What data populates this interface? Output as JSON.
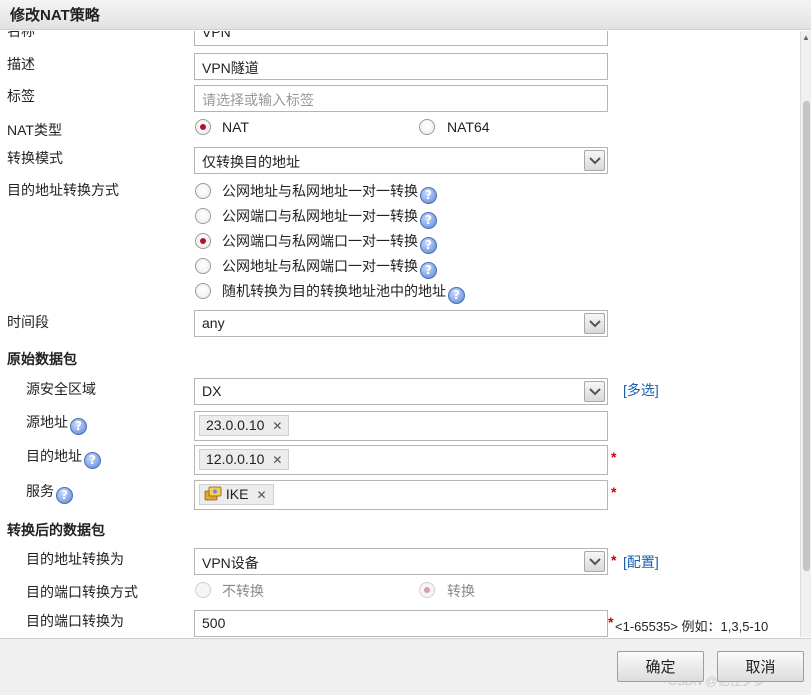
{
  "dialog": {
    "title": "修改NAT策略"
  },
  "form": {
    "name": {
      "label": "名称",
      "value": "VPN"
    },
    "description": {
      "label": "描述",
      "value": "VPN隧道"
    },
    "tag": {
      "label": "标签",
      "placeholder": "请选择或输入标签"
    },
    "nat_type": {
      "label": "NAT类型",
      "options": [
        "NAT",
        "NAT64"
      ],
      "selected": "NAT"
    },
    "convert_mode": {
      "label": "转换模式",
      "value": "仅转换目的地址"
    },
    "dest_convert_method": {
      "label": "目的地址转换方式",
      "options": [
        "公网地址与私网地址一对一转换",
        "公网端口与私网地址一对一转换",
        "公网端口与私网端口一对一转换",
        "公网地址与私网端口一对一转换",
        "随机转换为目的转换地址池中的地址"
      ],
      "selected_index": 2
    },
    "time_range": {
      "label": "时间段",
      "value": "any"
    }
  },
  "original_packet": {
    "section_title": "原始数据包",
    "source_zone": {
      "label": "源安全区域",
      "value": "DX",
      "link": "[多选]"
    },
    "source_address": {
      "label": "源地址",
      "tags": [
        "23.0.0.10"
      ]
    },
    "dest_address": {
      "label": "目的地址",
      "tags": [
        "12.0.0.10"
      ],
      "required": "*"
    },
    "service": {
      "label": "服务",
      "tags": [
        "IKE"
      ],
      "required": "*"
    }
  },
  "translated_packet": {
    "section_title": "转换后的数据包",
    "dest_address_to": {
      "label": "目的地址转换为",
      "value": "VPN设备",
      "required": "*",
      "link": "[配置]"
    },
    "dest_port_method": {
      "label": "目的端口转换方式",
      "options": [
        "不转换",
        "转换"
      ],
      "selected": "转换"
    },
    "dest_port_to": {
      "label": "目的端口转换为",
      "value": "500",
      "required": "*",
      "hint": "<1-65535> 例如：1,3,5-10"
    }
  },
  "buttons": {
    "ok": "确定",
    "cancel": "取消"
  },
  "watermark": "CSDN @忆往夕梦",
  "icons": {
    "help": "help-icon",
    "dropdown": "chevron-down-icon",
    "service": "service-icon",
    "remove": "close-icon"
  },
  "colors": {
    "radio_selected": "#b3112b",
    "link": "#1a5fb4",
    "required": "#d00000"
  }
}
